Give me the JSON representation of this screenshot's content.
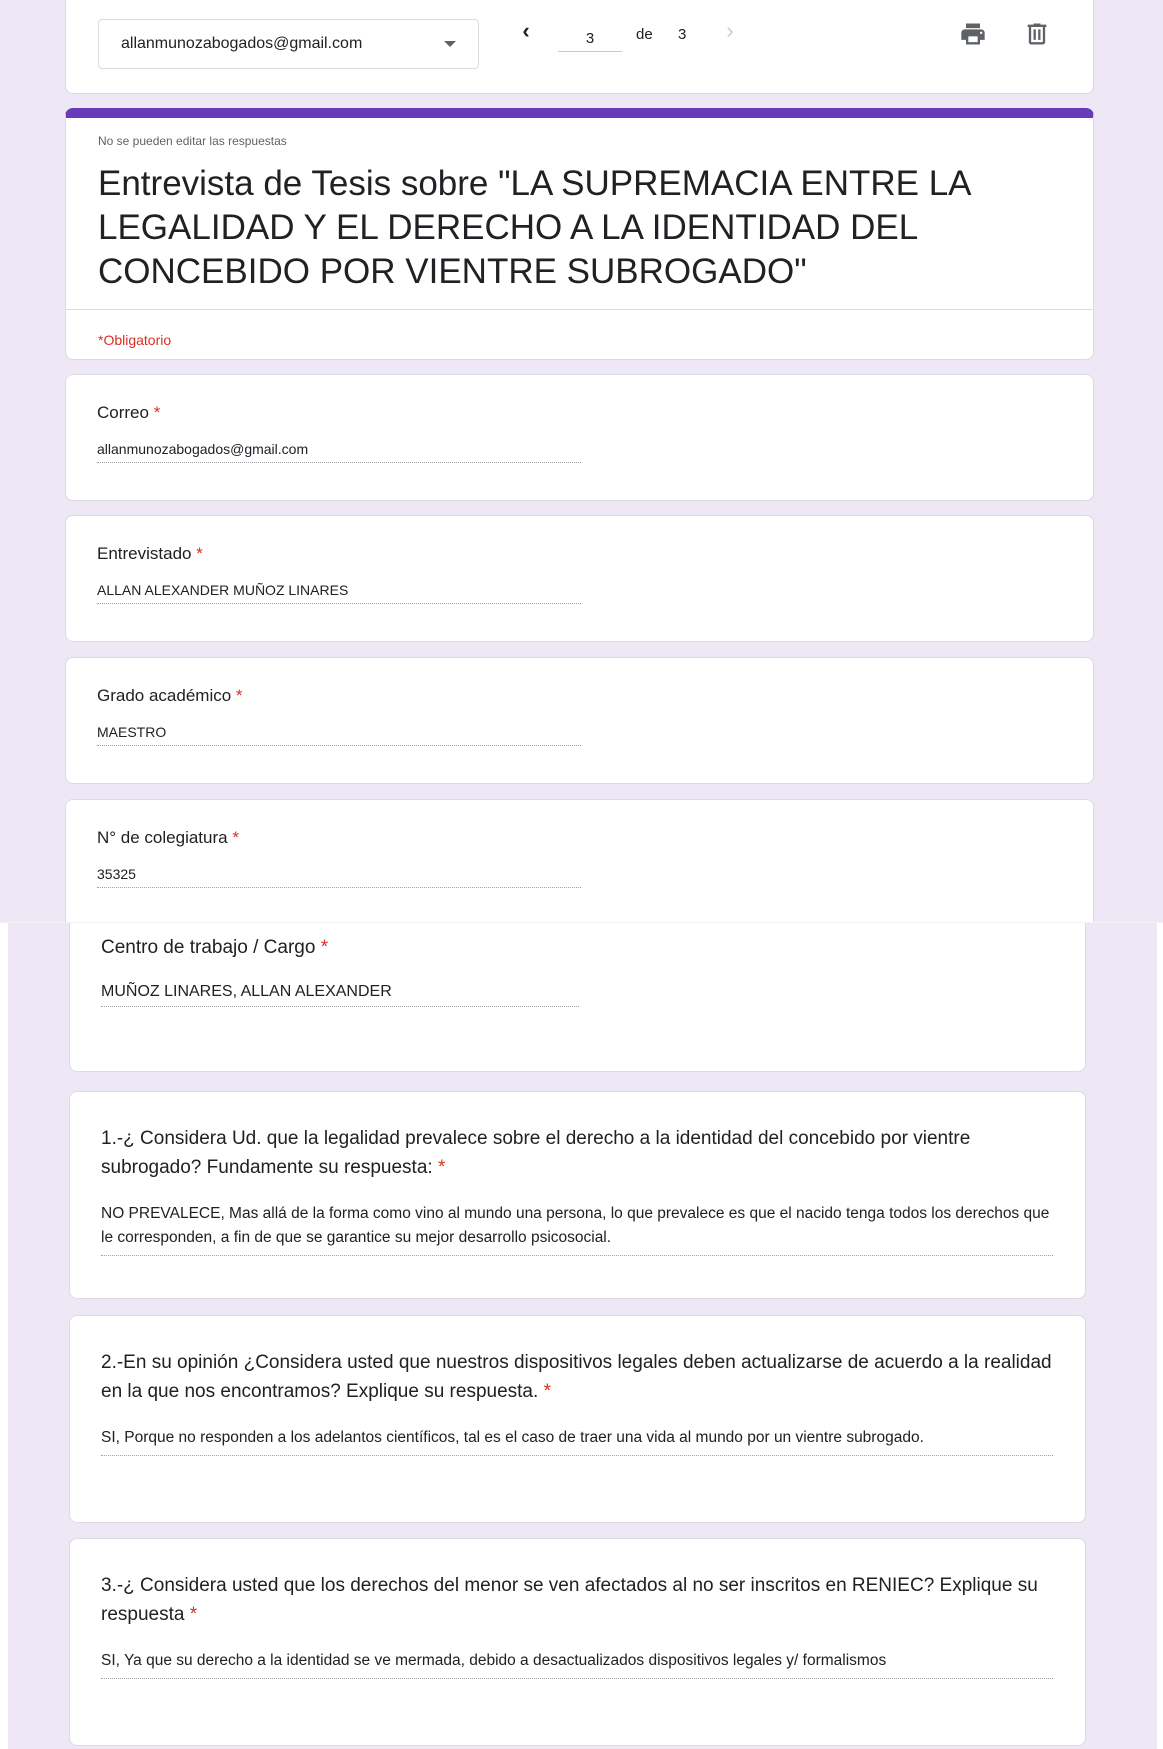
{
  "toolbar": {
    "account": "allanmunozabogados@gmail.com",
    "page_current": "3",
    "page_of": "de",
    "page_total": "3",
    "prev_icon": "‹",
    "next_icon": "›"
  },
  "header": {
    "note": "No se pueden editar las respuestas",
    "title": "Entrevista de Tesis sobre \"LA SUPREMACIA ENTRE LA LEGALIDAD Y EL DERECHO A LA IDENTIDAD DEL CONCEBIDO POR VIENTRE SUBROGADO\"",
    "required_note": "*Obligatorio"
  },
  "questions": [
    {
      "label": "Correo",
      "answer": "allanmunozabogados@gmail.com"
    },
    {
      "label": "Entrevistado",
      "answer": "ALLAN ALEXANDER MUÑOZ LINARES"
    },
    {
      "label": "Grado académico",
      "answer": "MAESTRO"
    },
    {
      "label": "N° de colegiatura",
      "answer": "35325"
    },
    {
      "label": "Centro de trabajo / Cargo",
      "answer": "MUÑOZ LINARES, ALLAN ALEXANDER"
    },
    {
      "label": "1.-¿ Considera Ud. que la legalidad prevalece sobre el derecho a la identidad del concebido por vientre subrogado? Fundamente su respuesta:",
      "answer": "NO PREVALECE, Mas allá de la forma como vino al mundo una persona, lo que prevalece es que el nacido tenga todos los derechos que le corresponden, a fin de que se garantice su mejor desarrollo psicosocial."
    },
    {
      "label": "2.-En su opinión ¿Considera usted que nuestros dispositivos legales deben actualizarse de acuerdo a la realidad en la que nos encontramos? Explique su respuesta.",
      "answer": "SI, Porque no responden a los adelantos científicos, tal es el caso de traer una vida al mundo por un vientre subrogado."
    },
    {
      "label": "3.-¿ Considera usted que los derechos del menor se ven afectados al no ser inscritos en RENIEC? Explique su respuesta",
      "answer": "SI, Ya que su derecho a la identidad se ve mermada, debido a desactualizados dispositivos legales y/ formalismos"
    }
  ],
  "required_marker": "*",
  "colors": {
    "accent": "#673ab7",
    "background": "#ede7f6",
    "required": "#d93025"
  },
  "icons": [
    "chevron-down-icon",
    "chevron-left-icon",
    "chevron-right-icon",
    "print-icon",
    "trash-icon"
  ]
}
